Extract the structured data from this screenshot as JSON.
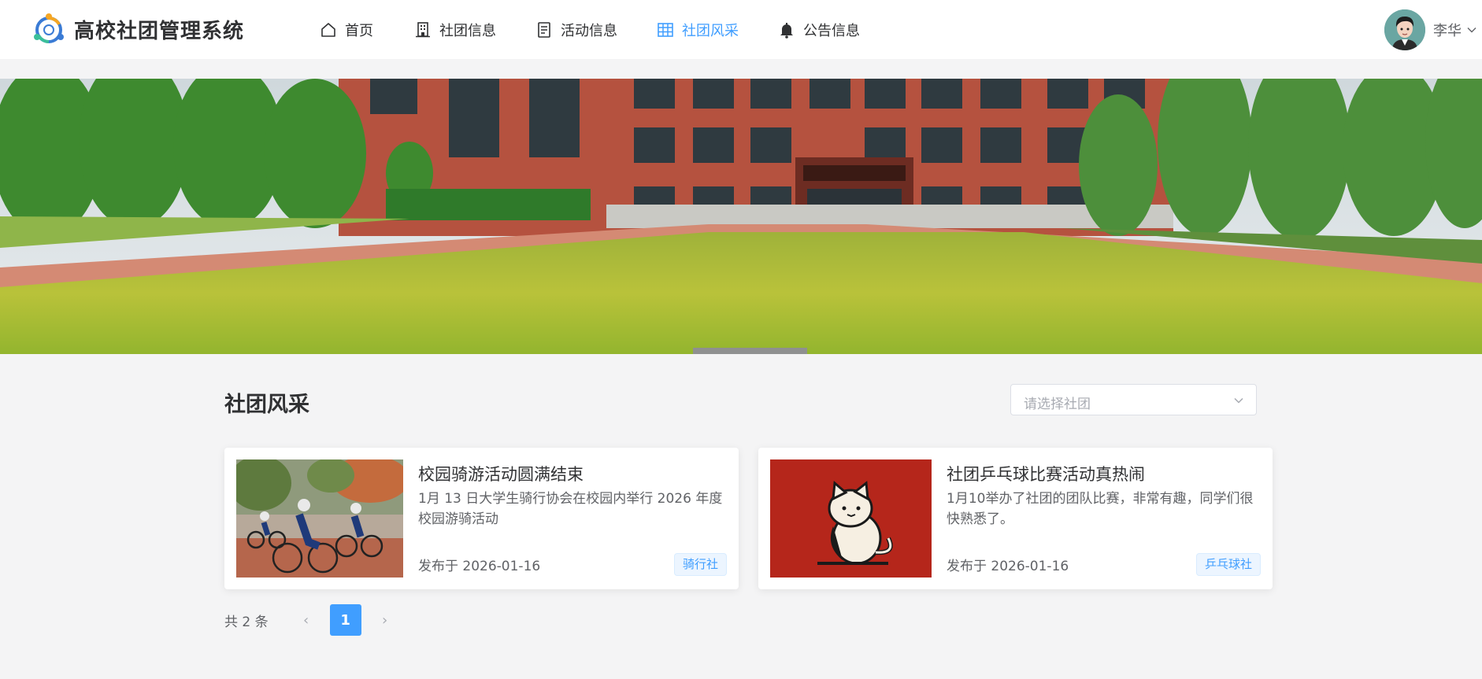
{
  "app": {
    "title": "高校社团管理系统"
  },
  "nav": {
    "items": [
      {
        "label": "首页",
        "icon": "home-icon"
      },
      {
        "label": "社团信息",
        "icon": "building-icon"
      },
      {
        "label": "活动信息",
        "icon": "document-icon"
      },
      {
        "label": "社团风采",
        "icon": "grid-icon",
        "active": true
      },
      {
        "label": "公告信息",
        "icon": "bell-icon"
      }
    ]
  },
  "user": {
    "name": "李华"
  },
  "section": {
    "title": "社团风采"
  },
  "filter": {
    "placeholder": "请选择社团"
  },
  "cards": [
    {
      "title": "校园骑游活动圆满结束",
      "desc": "1月 13 日大学生骑行协会在校园内举行 2026 年度校园游骑活动",
      "date": "发布于 2026-01-16",
      "tag": "骑行社"
    },
    {
      "title": "社团乒乓球比赛活动真热闹",
      "desc": "1月10举办了社团的团队比赛，非常有趣，同学们很快熟悉了。",
      "date": "发布于 2026-01-16",
      "tag": "乒乓球社"
    }
  ],
  "pagination": {
    "total": "共 2 条",
    "current": "1",
    "prev": "‹",
    "next": "›"
  },
  "colors": {
    "accent": "#409eff",
    "background": "#f4f4f5"
  }
}
